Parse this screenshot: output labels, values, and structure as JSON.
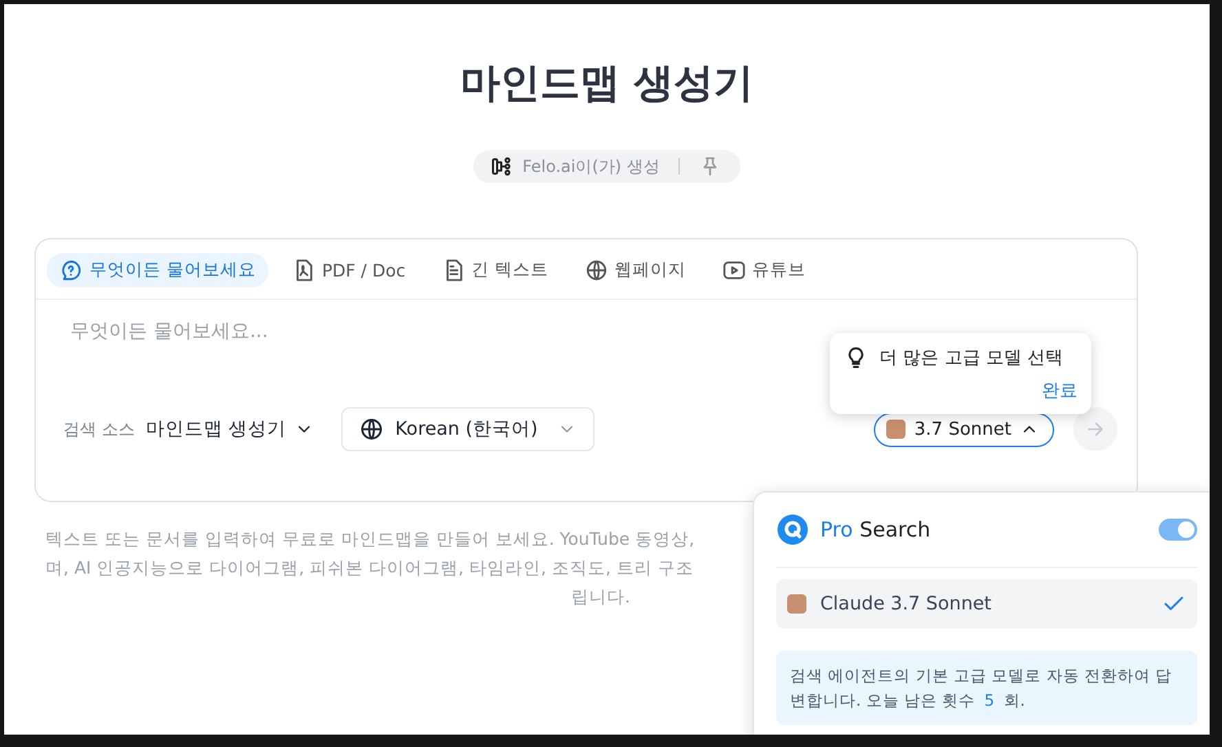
{
  "title": "마인드맵 생성기",
  "chip": {
    "label": "Felo.ai이(가) 생성"
  },
  "tabs": [
    {
      "label": "무엇이든 물어보세요",
      "kind": "question",
      "selected": true
    },
    {
      "label": "PDF / Doc",
      "kind": "pdf",
      "selected": false
    },
    {
      "label": "긴 텍스트",
      "kind": "doc",
      "selected": false
    },
    {
      "label": "웹페이지",
      "kind": "web",
      "selected": false
    },
    {
      "label": "유튜브",
      "kind": "video",
      "selected": false
    }
  ],
  "input": {
    "placeholder": "무엇이든 물어보세요..."
  },
  "source": {
    "label": "검색 소스",
    "value": "마인드맵 생성기"
  },
  "language": {
    "value": "Korean (한국어)"
  },
  "model_button": {
    "label": "3.7 Sonnet",
    "expanded": true
  },
  "tooltip": {
    "text": "더 많은 고급 모델 선택",
    "action": "완료"
  },
  "description": [
    "텍스트 또는 문서를 입력하여 무료로 마인드맵을 만들어 보세요. YouTube 동영상,",
    "며, AI 인공지능으로 다이어그램, 피쉬본 다이어그램, 타임라인, 조직도, 트리 구조",
    "립니다."
  ],
  "dropdown": {
    "pro_label": "Pro",
    "search_label": "Search",
    "pro_on": true,
    "models": [
      {
        "name": "Claude 3.7 Sonnet",
        "selected": true
      }
    ],
    "note": "검색 에이전트의 기본 고급 모델로 자동 전환하여 답변합니다. 오늘 남은 횟수 ",
    "count": "5",
    "count_suffix": " 회."
  }
}
